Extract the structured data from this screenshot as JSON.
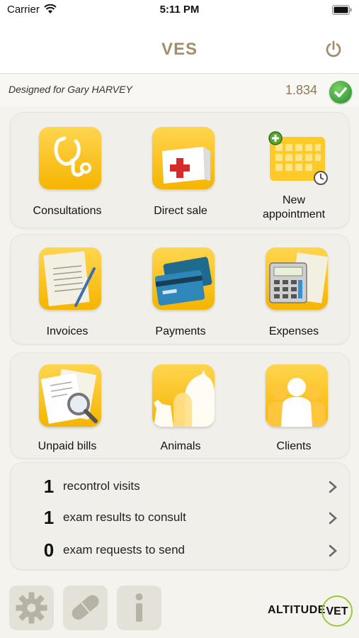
{
  "status_bar": {
    "carrier": "Carrier",
    "time": "5:11 PM"
  },
  "navbar": {
    "title": "VES"
  },
  "user": {
    "designed_for": "Designed for Gary HARVEY",
    "version": "1.834"
  },
  "panels": [
    {
      "tiles": [
        {
          "label": "Consultations",
          "icon": "stethoscope-icon"
        },
        {
          "label": "Direct sale",
          "icon": "first-aid-box-icon"
        },
        {
          "label": "New appointment",
          "label_line1": "New",
          "label_line2": "appointment",
          "icon": "calendar-add-icon"
        }
      ]
    },
    {
      "tiles": [
        {
          "label": "Invoices",
          "icon": "invoice-document-icon"
        },
        {
          "label": "Payments",
          "icon": "credit-cards-icon"
        },
        {
          "label": "Expenses",
          "icon": "calculator-icon"
        }
      ]
    },
    {
      "tiles": [
        {
          "label": "Unpaid bills",
          "icon": "bills-magnifier-icon"
        },
        {
          "label": "Animals",
          "icon": "animals-silhouette-icon"
        },
        {
          "label": "Clients",
          "icon": "people-silhouette-icon"
        }
      ]
    }
  ],
  "summary": [
    {
      "count": "1",
      "label": "recontrol visits"
    },
    {
      "count": "1",
      "label": "exam results to consult"
    },
    {
      "count": "0",
      "label": "exam requests to send"
    }
  ],
  "bottom_bar": {
    "buttons": [
      "gear-icon",
      "pill-icon",
      "info-icon"
    ],
    "logo_part1": "ALTITUDE",
    "logo_part2": "VET"
  },
  "colors": {
    "accent_yellow": "#f6b400",
    "title_brown": "#a38e6c",
    "check_green": "#3aa13a",
    "logo_green": "#9cc93b"
  }
}
